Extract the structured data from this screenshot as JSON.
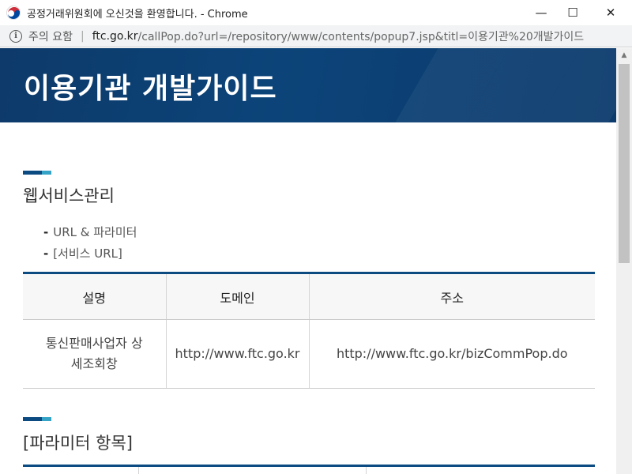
{
  "window": {
    "title": "공정거래위원회에 오신것을 환영합니다. - Chrome",
    "controls": {
      "minimize": "—",
      "maximize": "☐",
      "close": "✕"
    },
    "logo_icon": "korea-taegeuk-icon"
  },
  "address": {
    "warning": "주의 요함",
    "host": "ftc.go.kr",
    "path": "/callPop.do?url=/repository/www/contents/popup7.jsp&titl=이용기관%20개발가이드"
  },
  "page": {
    "banner_title": "이용기관 개발가이드",
    "section1": {
      "title": "웹서비스관리",
      "bullets": [
        "URL & 파라미터",
        "[서비스 URL]"
      ]
    },
    "url_table": {
      "headers": [
        "설명",
        "도메인",
        "주소"
      ],
      "rows": [
        {
          "desc_line1": "통신판매사업자 상",
          "desc_line2": "세조회창",
          "domain": "http://www.ftc.go.kr",
          "address": "http://www.ftc.go.kr/bizCommPop.do"
        }
      ]
    },
    "section2": {
      "title": "[파라미터 항목]"
    }
  },
  "colors": {
    "banner": "#0c4479",
    "accent": "#0b4b82",
    "accent_light": "#35a3c6"
  }
}
